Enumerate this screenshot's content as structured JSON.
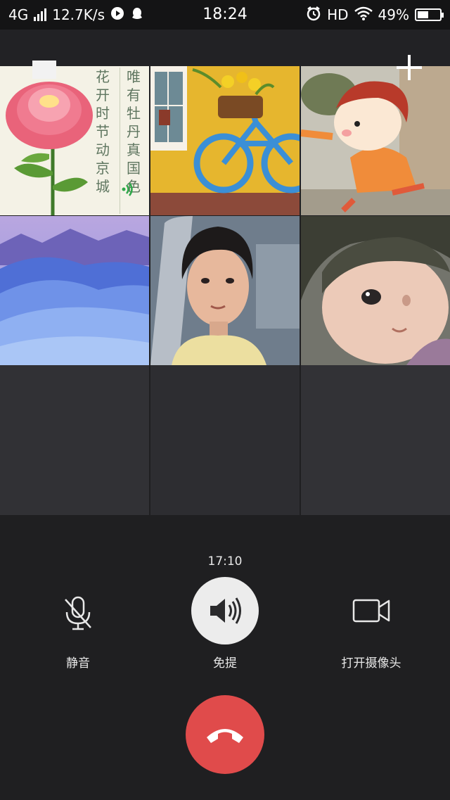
{
  "status_bar": {
    "network": "4G",
    "speed": "12.7K/s",
    "time": "18:24",
    "hd": "HD",
    "battery": "49%",
    "battery_level": 0.49
  },
  "call": {
    "timer": "17:10",
    "mute_label": "静音",
    "speaker_label": "免提",
    "camera_label": "打开摄像头"
  },
  "tiles": {
    "poem_right": [
      "唯",
      "有",
      "牡",
      "丹",
      "真",
      "国",
      "色"
    ],
    "poem_left": [
      "花",
      "开",
      "时",
      "节",
      "动",
      "京",
      "城"
    ]
  },
  "colors": {
    "hangup": "#e04b4b",
    "speaker_bg": "#ececec",
    "background": "#1f1f21"
  }
}
